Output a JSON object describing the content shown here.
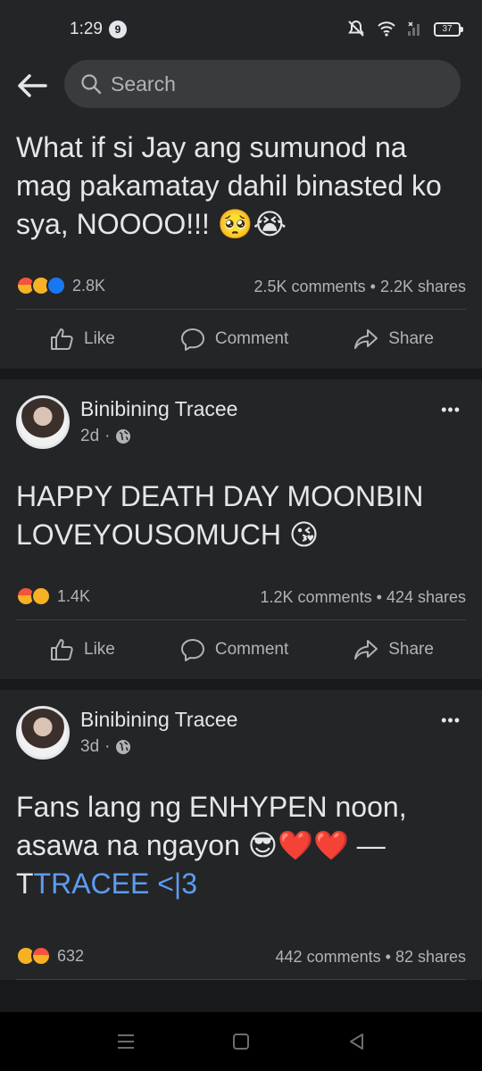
{
  "status": {
    "time": "1:29",
    "notification_count": "9",
    "battery": "37"
  },
  "header": {
    "search_placeholder": "Search"
  },
  "posts": [
    {
      "text": "What if si Jay ang sumunod na mag pakamatay dahil binasted ko sya, NOOOO!!! 🥺😭",
      "reactions": "2.8K",
      "comments": "2.5K comments",
      "shares": "2.2K shares"
    },
    {
      "author": "Binibining Tracee",
      "time": "2d",
      "text": "HAPPY DEATH DAY MOONBIN LOVEYOUSOMUCH 😘",
      "reactions": "1.4K",
      "comments": "1.2K comments",
      "shares": "424 shares"
    },
    {
      "author": "Binibining Tracee",
      "time": "3d",
      "text_main": "Fans lang ng ENHYPEN noon, asawa na ngayon 😎❤️❤️ — T",
      "text_link": "TRACEE <|3",
      "reactions": "632",
      "comments": "442 comments",
      "shares": "82 shares"
    }
  ],
  "actions": {
    "like": "Like",
    "comment": "Comment",
    "share": "Share"
  },
  "separator": "•",
  "more": "•••"
}
